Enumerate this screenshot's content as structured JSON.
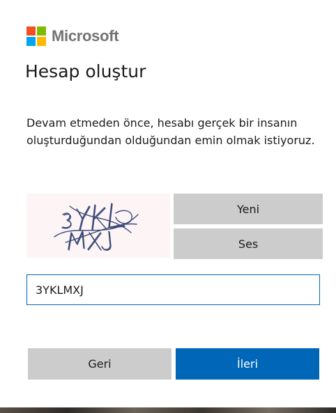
{
  "brand": {
    "name": "Microsoft",
    "colors": [
      "#f25022",
      "#7fba00",
      "#00a4ef",
      "#ffb900"
    ]
  },
  "page": {
    "title": "Hesap oluştur",
    "description": "Devam etmeden önce, hesabı gerçek bir insanın oluşturduğundan olduğundan emin olmak istiyoruz."
  },
  "captcha": {
    "new_label": "Yeni",
    "audio_label": "Ses",
    "input_value": "3YKLMXJ"
  },
  "actions": {
    "back_label": "Geri",
    "next_label": "İleri"
  },
  "colors": {
    "accent": "#0067b8",
    "secondary_button": "#cccccc"
  }
}
